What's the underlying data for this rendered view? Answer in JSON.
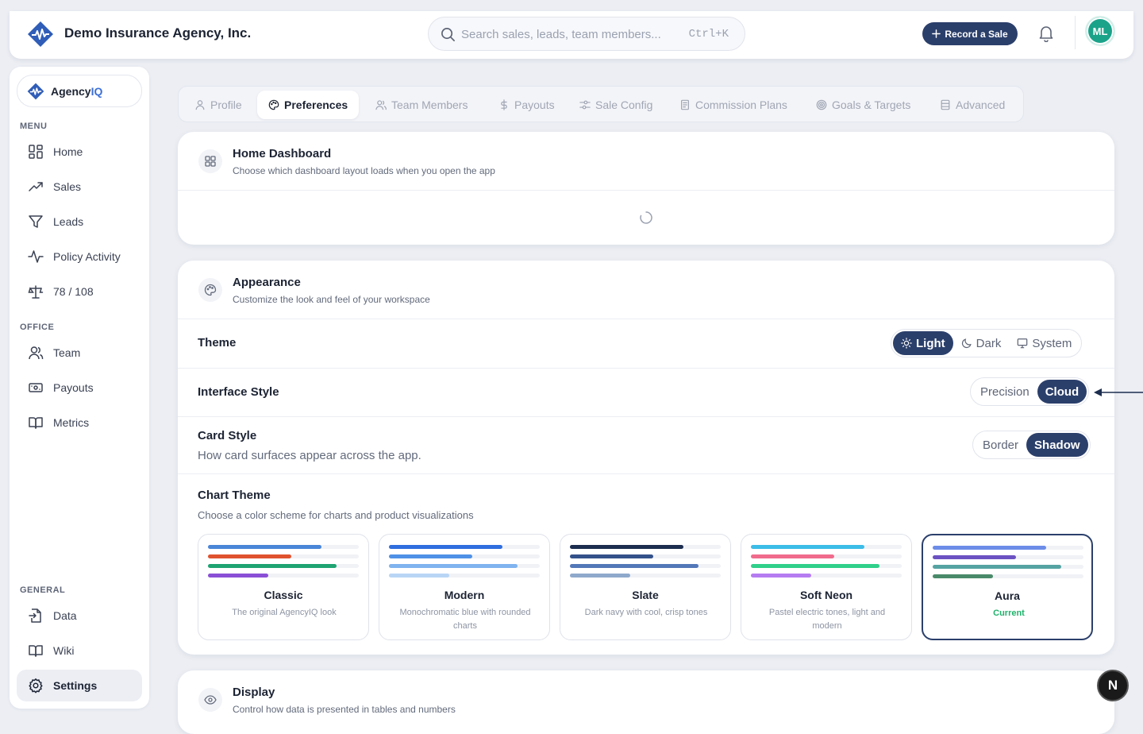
{
  "header": {
    "company": "Demo Insurance Agency, Inc.",
    "search_placeholder": "Search sales, leads, team members...",
    "search_shortcut": "Ctrl+K",
    "record_button": "Record a Sale",
    "avatar_initials": "ML"
  },
  "sidebar": {
    "brand_prefix": "Agency",
    "brand_suffix": "IQ",
    "menu_label": "MENU",
    "menu_items": [
      {
        "label": "Home",
        "icon": "grid-icon"
      },
      {
        "label": "Sales",
        "icon": "trending-up-icon"
      },
      {
        "label": "Leads",
        "icon": "filter-icon"
      },
      {
        "label": "Policy Activity",
        "icon": "activity-icon"
      },
      {
        "label": "78 / 108",
        "icon": "scale-icon"
      }
    ],
    "office_label": "OFFICE",
    "office_items": [
      {
        "label": "Team",
        "icon": "users-icon"
      },
      {
        "label": "Payouts",
        "icon": "banknote-icon"
      },
      {
        "label": "Metrics",
        "icon": "book-open-icon"
      }
    ],
    "general_label": "GENERAL",
    "general_items": [
      {
        "label": "Data",
        "icon": "file-import-icon"
      },
      {
        "label": "Wiki",
        "icon": "book-icon"
      },
      {
        "label": "Settings",
        "icon": "gear-icon",
        "active": true
      }
    ]
  },
  "tabs": [
    {
      "label": "Profile",
      "icon": "user-icon"
    },
    {
      "label": "Preferences",
      "icon": "palette-icon",
      "active": true
    },
    {
      "label": "Team Members",
      "icon": "users-icon"
    },
    {
      "label": "Payouts",
      "icon": "dollar-icon"
    },
    {
      "label": "Sale Config",
      "icon": "sliders-icon"
    },
    {
      "label": "Commission Plans",
      "icon": "document-icon"
    },
    {
      "label": "Goals & Targets",
      "icon": "target-icon"
    },
    {
      "label": "Advanced",
      "icon": "database-icon"
    }
  ],
  "home_dashboard": {
    "title": "Home Dashboard",
    "subtitle": "Choose which dashboard layout loads when you open the app"
  },
  "appearance": {
    "title": "Appearance",
    "subtitle": "Customize the look and feel of your workspace",
    "theme_label": "Theme",
    "theme_options": [
      "Light",
      "Dark",
      "System"
    ],
    "theme_selected": "Light",
    "interface_label": "Interface Style",
    "interface_options": [
      "Precision",
      "Cloud"
    ],
    "interface_selected": "Cloud",
    "card_style_label": "Card Style",
    "card_style_sub": "How card surfaces appear across the app.",
    "card_style_options": [
      "Border",
      "Shadow"
    ],
    "card_style_selected": "Shadow",
    "chart_theme_label": "Chart Theme",
    "chart_theme_sub": "Choose a color scheme for charts and product visualizations",
    "chart_themes": [
      {
        "name": "Classic",
        "desc": "The original AgencyIQ look",
        "colors": [
          "#4a86d8",
          "#e0532f",
          "#1ea372",
          "#8a4fd6"
        ],
        "fills": [
          0.75,
          0.55,
          0.85,
          0.4
        ]
      },
      {
        "name": "Modern",
        "desc": "Monochromatic blue with rounded charts",
        "colors": [
          "#2f6ede",
          "#4f91e6",
          "#7fb3ef",
          "#b9d5f6"
        ],
        "fills": [
          0.75,
          0.55,
          0.85,
          0.4
        ]
      },
      {
        "name": "Slate",
        "desc": "Dark navy with cool, crisp tones",
        "colors": [
          "#1c2d4f",
          "#33518a",
          "#5378b8",
          "#8fa9cc"
        ],
        "fills": [
          0.75,
          0.55,
          0.85,
          0.4
        ]
      },
      {
        "name": "Soft Neon",
        "desc": "Pastel electric tones, light and modern",
        "colors": [
          "#3cbde8",
          "#f06b8c",
          "#2fd08a",
          "#b57cf2"
        ],
        "fills": [
          0.75,
          0.55,
          0.85,
          0.4
        ]
      },
      {
        "name": "Aura",
        "desc": "Current",
        "colors": [
          "#6c8ce8",
          "#6b52c2",
          "#56a3a3",
          "#4a8a6a"
        ],
        "fills": [
          0.75,
          0.55,
          0.85,
          0.4
        ],
        "current": true
      }
    ]
  },
  "display": {
    "title": "Display",
    "subtitle": "Control how data is presented in tables and numbers"
  },
  "badge_letter": "N"
}
